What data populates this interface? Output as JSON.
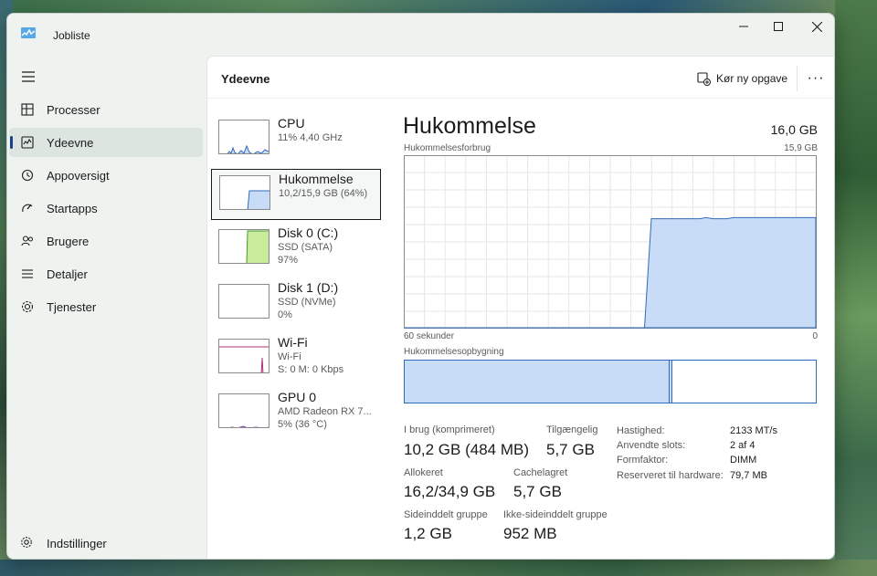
{
  "window": {
    "title": "Jobliste",
    "app_icon": "task-manager-icon"
  },
  "nav": {
    "menu_icon": "hamburger-icon",
    "items": [
      {
        "label": "Processer",
        "icon": "processes-icon",
        "active": false
      },
      {
        "label": "Ydeevne",
        "icon": "performance-icon",
        "active": true
      },
      {
        "label": "Appoversigt",
        "icon": "app-history-icon",
        "active": false
      },
      {
        "label": "Startapps",
        "icon": "startup-icon",
        "active": false
      },
      {
        "label": "Brugere",
        "icon": "users-icon",
        "active": false
      },
      {
        "label": "Detaljer",
        "icon": "details-icon",
        "active": false
      },
      {
        "label": "Tjenester",
        "icon": "services-icon",
        "active": false
      }
    ],
    "settings_label": "Indstillinger"
  },
  "header": {
    "title": "Ydeevne",
    "run_task_label": "Kør ny opgave",
    "more_label": "···"
  },
  "devices": [
    {
      "name": "CPU",
      "line1": "11%  4,40 GHz",
      "line2": "",
      "color": "#2f6bb8",
      "fill": "#c9dcf7"
    },
    {
      "name": "Hukommelse",
      "line1": "10,2/15,9 GB (64%)",
      "line2": "",
      "color": "#2f6bb8",
      "fill": "#c9dcf7"
    },
    {
      "name": "Disk 0 (C:)",
      "line1": "SSD (SATA)",
      "line2": "97%",
      "color": "#4d9a2f",
      "fill": "#c8ec9c"
    },
    {
      "name": "Disk 1 (D:)",
      "line1": "SSD (NVMe)",
      "line2": "0%",
      "color": "#4d9a2f",
      "fill": "#c8ec9c"
    },
    {
      "name": "Wi-Fi",
      "line1": "Wi-Fi",
      "line2": "S: 0  M: 0 Kbps",
      "color": "#b0307a",
      "fill": "#f2c9e0"
    },
    {
      "name": "GPU 0",
      "line1": "AMD Radeon RX 7...",
      "line2": "5%  (36 °C)",
      "color": "#7a3ab0",
      "fill": "#e2d0f2"
    }
  ],
  "memory": {
    "title": "Hukommelse",
    "total": "16,0 GB",
    "usage_label": "Hukommelsesforbrug",
    "usage_max": "15,9 GB",
    "x_left": "60 sekunder",
    "x_right": "0",
    "composition_label": "Hukommelsesopbygning",
    "stats": [
      {
        "label": "I brug (komprimeret)",
        "value": "10,2 GB (484 MB)"
      },
      {
        "label": "Tilgængelig",
        "value": "5,7 GB"
      },
      {
        "label": "Allokeret",
        "value": "16,2/34,9 GB"
      },
      {
        "label": "Cachelagret",
        "value": "5,7 GB"
      },
      {
        "label": "Sideinddelt gruppe",
        "value": "1,2 GB"
      },
      {
        "label": "Ikke-sideinddelt gruppe",
        "value": "952 MB"
      }
    ],
    "details": [
      {
        "key": "Hastighed:",
        "value": "2133 MT/s"
      },
      {
        "key": "Anvendte slots:",
        "value": "2 af 4"
      },
      {
        "key": "Formfaktor:",
        "value": "DIMM"
      },
      {
        "key": "Reserveret til hardware:",
        "value": "79,7 MB"
      }
    ]
  },
  "chart_data": {
    "type": "area",
    "x_range_seconds": [
      60,
      0
    ],
    "y_range_gb": [
      0,
      15.9
    ],
    "values_gb": [
      0,
      0,
      0,
      0,
      0,
      0,
      0,
      0,
      0,
      0,
      0,
      0,
      0,
      0,
      0,
      0,
      0,
      0,
      0,
      0,
      0,
      0,
      0,
      0,
      0,
      0,
      0,
      0,
      0,
      0,
      0,
      0,
      0,
      0,
      0,
      0,
      10.1,
      10.1,
      10.1,
      10.1,
      10.1,
      10.1,
      10.1,
      10.1,
      10.2,
      10.1,
      10.1,
      10.1,
      10.2,
      10.2,
      10.2,
      10.2,
      10.2,
      10.2,
      10.2,
      10.2,
      10.2,
      10.2,
      10.2,
      10.2,
      10.2
    ],
    "grid": true
  }
}
